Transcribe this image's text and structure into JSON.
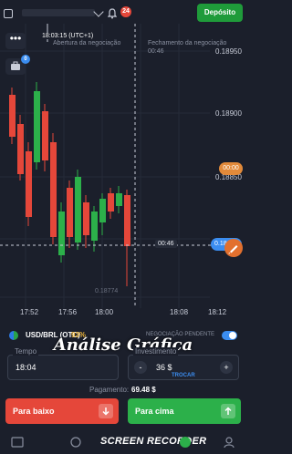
{
  "topbar": {
    "notifications_count": "24",
    "deposit_label": "Depósito"
  },
  "left_tools": {
    "menu_label": "•••",
    "portfolio_badge": "0"
  },
  "chart": {
    "current_time": "18:03:15 (UTC+1)",
    "open_label": "Abertura da negociação",
    "close_label": "Fechamento da negociação",
    "close_countdown": "00:46",
    "prices": [
      "0.18950",
      "0.18900",
      "0.18850"
    ],
    "time_badge": "00:00",
    "line_time": "00:46",
    "current_price": "0.18",
    "low_price": "0.18774",
    "x_ticks": [
      "17:52",
      "17:56",
      "18:00",
      "18:08",
      "18:12"
    ]
  },
  "asset": {
    "name": "USD/BRL (OTC)",
    "payout_pct": "93%",
    "pending_label": "NEGOCIAÇÃO PENDENTE"
  },
  "overlay_title": "Análise Gráfica",
  "order": {
    "time_label": "Tempo",
    "time_value": "18:04",
    "amount_label": "Investimento",
    "amount_value": "36 $",
    "minus": "-",
    "plus": "+",
    "switch_label": "TROCAR",
    "payout_label": "Pagamento:",
    "payout_value": "69.48 $"
  },
  "buttons": {
    "down_label": "Para baixo",
    "up_label": "Para cima"
  },
  "bottom": {
    "recorder_text": "SCREEN RECORDER"
  },
  "colors": {
    "bull": "#2cb04a",
    "bear": "#e5473a",
    "accent": "#3b8df0"
  }
}
